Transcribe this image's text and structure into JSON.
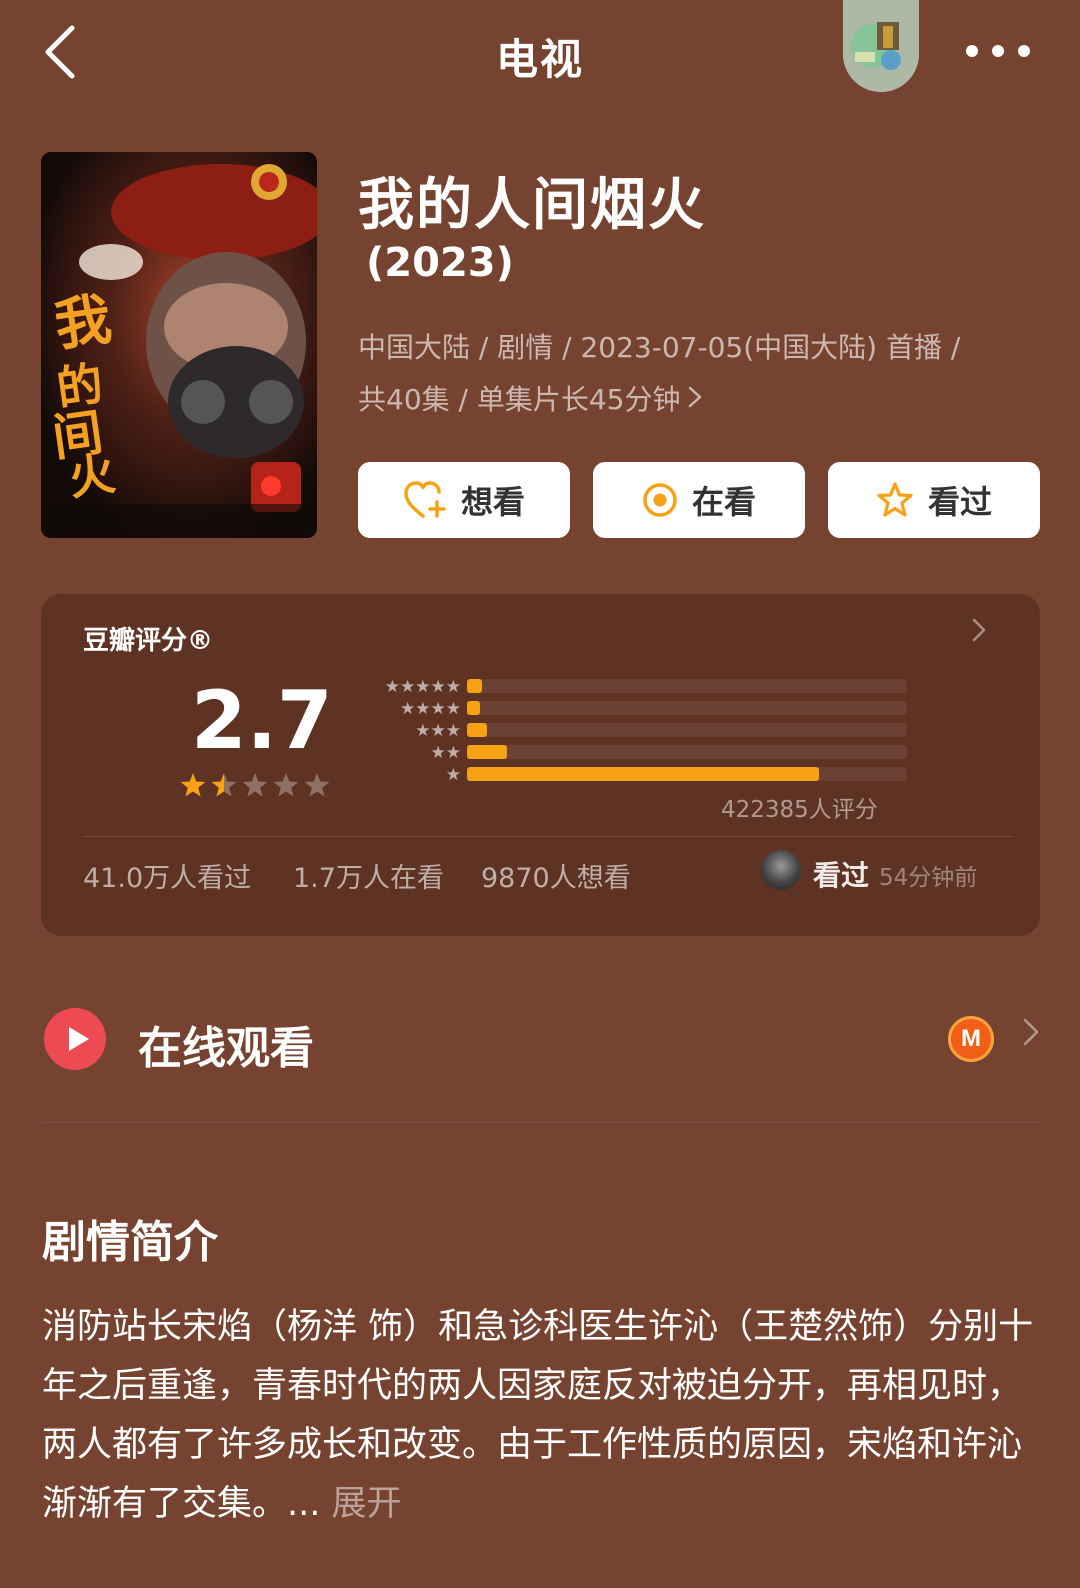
{
  "nav": {
    "title": "电视"
  },
  "show": {
    "title": "我的人间烟火",
    "year": "(2023)",
    "meta_line1": "中国大陆 / 剧情 / 2023-07-05(中国大陆) 首播 /",
    "meta_line2": "共40集 / 单集片长45分钟"
  },
  "actions": {
    "want": "想看",
    "watching": "在看",
    "watched": "看过"
  },
  "rating": {
    "label": "豆瓣评分®",
    "score": "2.7",
    "star_level": 1.5,
    "star_max": 5,
    "distribution": [
      {
        "stars": "★★★★★",
        "fraction": 0.035
      },
      {
        "stars": "★★★★",
        "fraction": 0.03
      },
      {
        "stars": "★★★",
        "fraction": 0.045
      },
      {
        "stars": "★★",
        "fraction": 0.09
      },
      {
        "stars": "★",
        "fraction": 0.8
      }
    ],
    "count": "422385人评分",
    "stats": {
      "watched": "41.0万人看过",
      "watching": "1.7万人在看",
      "want": "9870人想看"
    },
    "friend": {
      "action": "看过",
      "time": "54分钟前"
    }
  },
  "watch_online": {
    "label": "在线观看",
    "provider_logo_text": "M"
  },
  "synopsis": {
    "title": "剧情简介",
    "text": "消防站长宋焰（杨洋 饰）和急诊科医生许沁（王楚然饰）分别十年之后重逢，青春时代的两人因家庭反对被迫分开，再相见时，两人都有了许多成长和改变。由于工作性质的原因，宋焰和许沁渐渐有了交集。... ",
    "expand": "展开"
  },
  "colors": {
    "background": "#764331",
    "card": "#5f3324",
    "accent_orange": "#f6a214",
    "play_red": "#ee4a54"
  }
}
